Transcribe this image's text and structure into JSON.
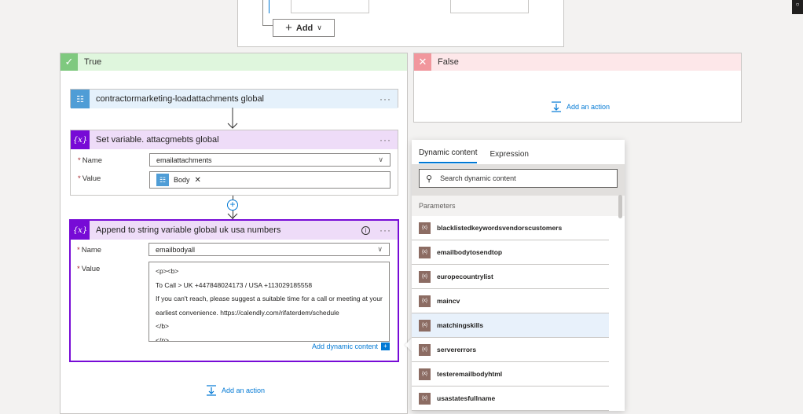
{
  "top": {
    "add_label": "Add"
  },
  "true_branch": {
    "title": "True",
    "add_action": "Add an action"
  },
  "false_branch": {
    "title": "False",
    "add_action": "Add an action"
  },
  "card1": {
    "title": "contractormarketing-loadattachments global"
  },
  "card2": {
    "title": "Set variable. attacgmebts global",
    "name_label": "Name",
    "name_value": "emailattachments",
    "value_label": "Value",
    "token": "Body"
  },
  "card3": {
    "title": "Append to string variable global uk usa numbers",
    "name_label": "Name",
    "name_value": "emailbodyall",
    "value_label": "Value",
    "lines": [
      "<p><b>",
      "To Call > UK +447848024173 / USA +113029185558",
      "If you can't reach, please suggest a suitable time for a call or meeting at your",
      "earliest convenience. https://calendly.com/rifaterdem/schedule",
      "</b>",
      "</p>"
    ],
    "add_dynamic": "Add dynamic content"
  },
  "panel": {
    "tabs": [
      "Dynamic content",
      "Expression"
    ],
    "search_placeholder": "Search dynamic content",
    "section": "Parameters",
    "items": [
      "blacklistedkeywordsvendorscustomers",
      "emailbodytosendtop",
      "europecountrylist",
      "maincv",
      "matchingskills",
      "servererrors",
      "testeremailbodyhtml",
      "usastatesfullname"
    ],
    "item_icon_label": "{x}"
  },
  "colors": {
    "true_header": "#dff6dd",
    "true_accent": "#7fc97f",
    "false_header": "#fde7e9",
    "false_accent": "#f1979d",
    "variable_header": "#eedcf8",
    "http_header": "#e5f1fb",
    "selected_border": "#770bd6",
    "link": "#0078d4"
  }
}
